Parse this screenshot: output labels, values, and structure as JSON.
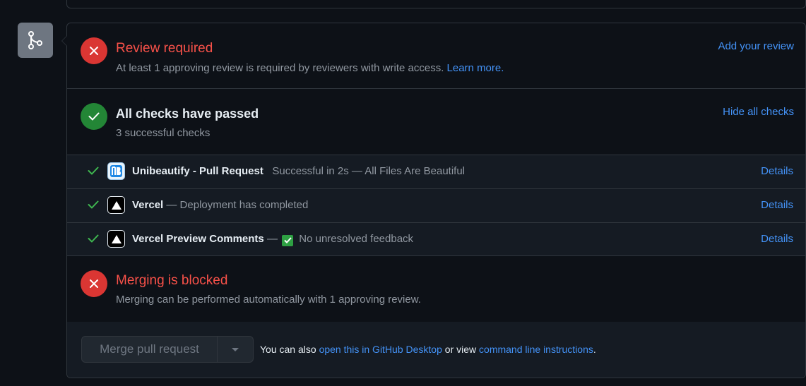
{
  "review": {
    "title": "Review required",
    "subtitle": "At least 1 approving review is required by reviewers with write access.",
    "learn_more": "Learn more.",
    "add_review": "Add your review"
  },
  "checks": {
    "title": "All checks have passed",
    "subtitle": "3 successful checks",
    "hide_all": "Hide all checks",
    "rows": [
      {
        "name": "Unibeautify - Pull Request",
        "desc": "Successful in 2s — All Files Are Beautiful",
        "details": "Details",
        "icon": "unibeautify-icon"
      },
      {
        "name": "Vercel",
        "desc": "— Deployment has completed",
        "details": "Details",
        "icon": "vercel-icon"
      },
      {
        "name": "Vercel Preview Comments",
        "desc_prefix": "—",
        "desc": "No unresolved feedback",
        "details": "Details",
        "icon": "vercel-icon"
      }
    ]
  },
  "merging": {
    "title": "Merging is blocked",
    "subtitle": "Merging can be performed automatically with 1 approving review."
  },
  "footer": {
    "merge_label": "Merge pull request",
    "text_1": "You can also",
    "link_desktop": "open this in GitHub Desktop",
    "text_2": "or view",
    "link_cli": "command line instructions",
    "text_3": "."
  },
  "colors": {
    "red": "#da3633",
    "green": "#238636",
    "link": "#4493f8"
  }
}
